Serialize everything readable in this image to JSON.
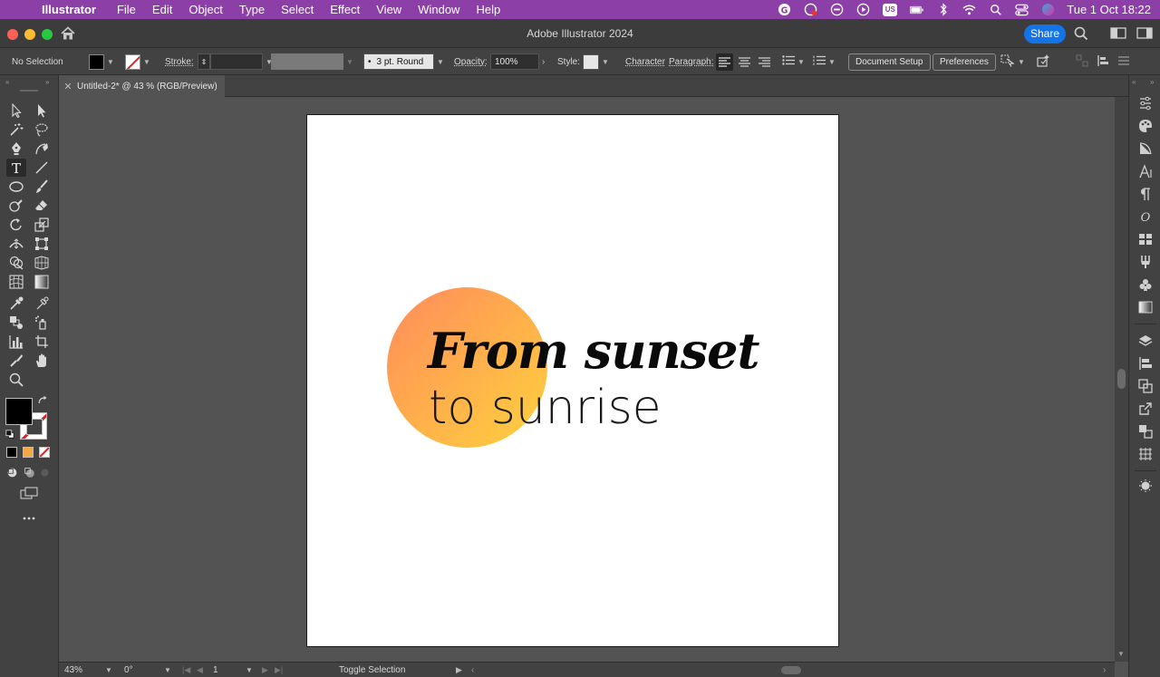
{
  "menubar": {
    "app_name": "Illustrator",
    "items": [
      "File",
      "Edit",
      "Object",
      "Type",
      "Select",
      "Effect",
      "View",
      "Window",
      "Help"
    ],
    "input_badge": "US",
    "clock": "Tue 1 Oct  18:22"
  },
  "titlebar": {
    "title": "Adobe Illustrator 2024",
    "share_label": "Share"
  },
  "controlbar": {
    "selection": "No Selection",
    "stroke_label": "Stroke:",
    "brush_value": "3 pt. Round",
    "opacity_label": "Opacity:",
    "opacity_value": "100%",
    "style_label": "Style:",
    "character_label": "Character",
    "paragraph_label": "Paragraph:",
    "document_setup_label": "Document Setup",
    "preferences_label": "Preferences"
  },
  "tab": {
    "title": "Untitled-2* @ 43 % (RGB/Preview)"
  },
  "artwork": {
    "headline": "From sunset",
    "subline": "to sunrise",
    "gradient_colors": [
      "#ff8a5c",
      "#ffb24a",
      "#ffd23d"
    ]
  },
  "statusbar": {
    "zoom": "43%",
    "rotation": "0°",
    "artboard_number": "1",
    "status_text": "Toggle Selection"
  },
  "colors": {
    "menubar_bg": "#8c3fa6",
    "accent": "#1473e6",
    "ui_dark": "#424242",
    "canvas_bg": "#535353"
  }
}
